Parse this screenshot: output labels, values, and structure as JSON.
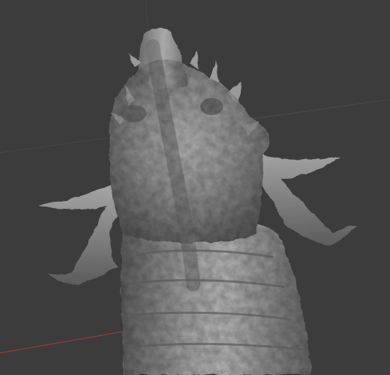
{
  "viewport": {
    "kind": "3d-sculpt-viewport",
    "subject": "dragon-head-sculpt",
    "background_color": "#3c3c3c",
    "grid_color": "#474747",
    "x_axis_color": "#a03a3a",
    "y_axis_color": "#5a8a3a",
    "z_axis_color": "#5a5aa8",
    "model_base_color": "#8c8c8c",
    "model_highlight_color": "#c9c9c9",
    "model_shadow_color": "#4a4a4a"
  }
}
